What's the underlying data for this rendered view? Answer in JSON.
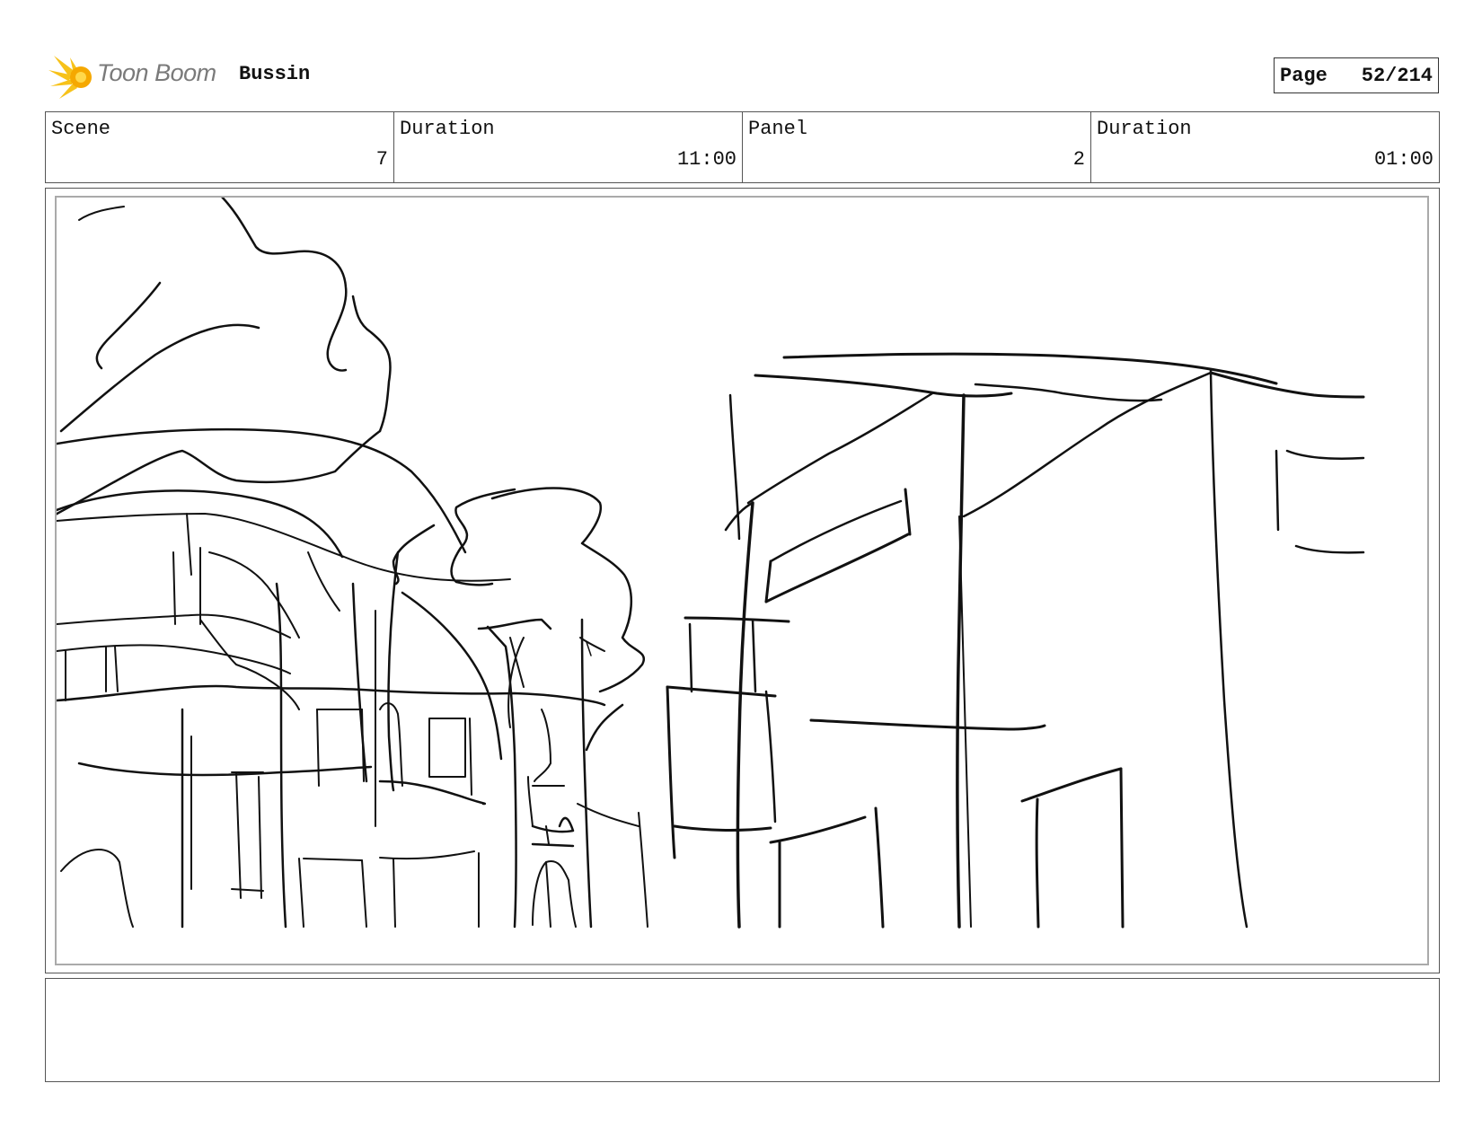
{
  "header": {
    "logo_text": "Toon Boom",
    "project_title": "Bussin",
    "page_label": "Page",
    "page_number": "52/214"
  },
  "info": {
    "scene_label": "Scene",
    "scene_value": "7",
    "scene_duration_label": "Duration",
    "scene_duration_value": "11:00",
    "panel_label": "Panel",
    "panel_value": "2",
    "panel_duration_label": "Duration",
    "panel_duration_value": "01:00"
  },
  "panel": {
    "image_name": "sketch-street-buildings-trees"
  },
  "notes": {
    "text": ""
  }
}
